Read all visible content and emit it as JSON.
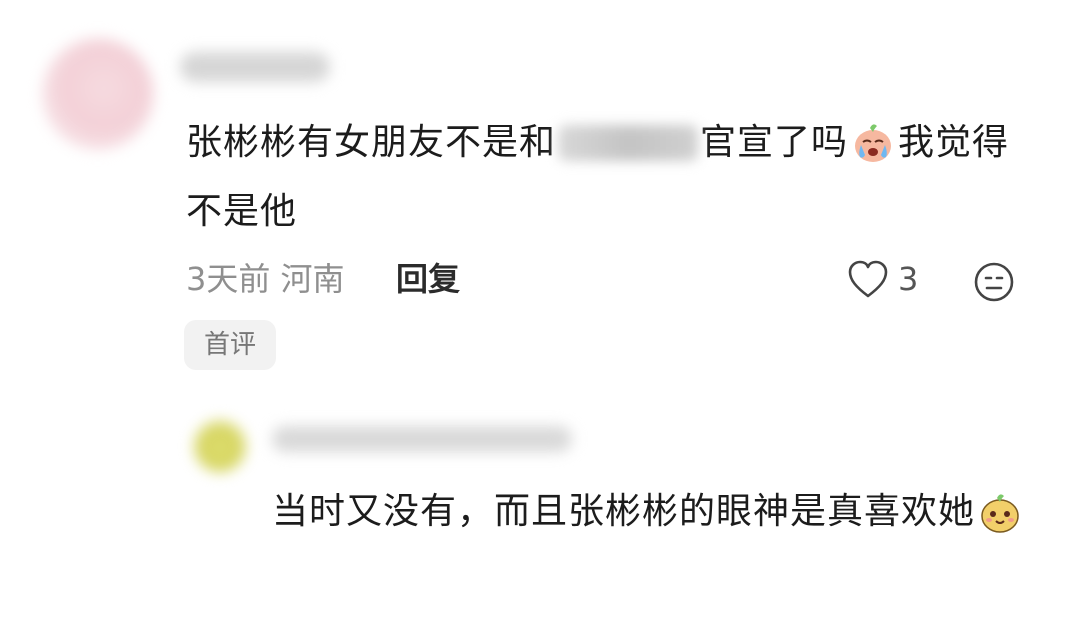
{
  "comment": {
    "text_before": "张彬彬有女朋友不是和",
    "text_after": "官宣了吗",
    "text_end": "我觉得不是他",
    "emoji": "crying-face-emoji",
    "time": "3天前",
    "location": "河南",
    "reply_label": "回复",
    "like_count": "3",
    "badge": "首评"
  },
  "reply": {
    "text": "当时又没有，而且张彬彬的眼神是真喜欢她",
    "emoji": "smiling-potato-emoji"
  },
  "colors": {
    "text": "#1c1c1c",
    "meta": "#8f8f8f",
    "badge_bg": "#f2f2f2"
  }
}
